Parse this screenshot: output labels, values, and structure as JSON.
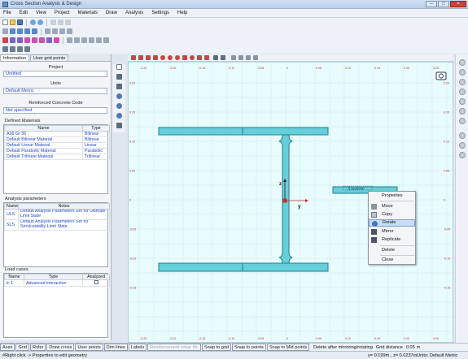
{
  "window": {
    "title": "Cross Section Analysis & Design"
  },
  "menu": [
    "File",
    "Edit",
    "View",
    "Project",
    "Materials",
    "Draw",
    "Analysis",
    "Settings",
    "Help"
  ],
  "tabs": [
    "Information",
    "User grid points"
  ],
  "project": {
    "label": "Project",
    "value": "Untitled"
  },
  "units": {
    "label": "Units",
    "value": "Default Metric"
  },
  "concrete_code": {
    "label": "Reinforced Concrete Code",
    "value": "Not specified"
  },
  "materials": {
    "title": "Defined Materials",
    "headers": [
      "Name",
      "Type"
    ],
    "rows": [
      [
        "A36 Gr 36",
        "Bilinear"
      ],
      [
        "Default Bilinear Material",
        "Bilinear"
      ],
      [
        "Default Linear Material",
        "Linear"
      ],
      [
        "Default Parabolic Material",
        "Parabolic"
      ],
      [
        "Default Trilinear Material",
        "Trilinear"
      ]
    ]
  },
  "analysis_params": {
    "title": "Analysis parameters",
    "headers": [
      "Name",
      "Notes"
    ],
    "rows": [
      [
        "ULS",
        "Default Analysis Parameters Set for Ultimate Limit State"
      ],
      [
        "SLS",
        "Default Analysis Parameters Set for Serviceability Limit State"
      ]
    ]
  },
  "load_cases": {
    "title": "Load cases",
    "headers": [
      "Name",
      "Type",
      "Analyzed"
    ],
    "rows": [
      [
        "lc 1",
        "Advanced interaction",
        ""
      ]
    ]
  },
  "axis_ticks": {
    "top": [
      "-0.25",
      "-0.20",
      "-0.15",
      "-0.10",
      "-0.05",
      "0",
      "0.05",
      "0.10",
      "0.15",
      "0.20",
      "0.25"
    ],
    "left": [
      "0.20",
      "0.15",
      "0.10",
      "0.05",
      "0",
      "-0.05",
      "-0.10",
      "-0.15"
    ]
  },
  "canvas": {
    "axis_z": "z",
    "axis_y": "y",
    "selected_label": "2 sections"
  },
  "context_menu": [
    "Properties",
    "Move",
    "Copy",
    "Rotate",
    "Mirror",
    "Replicate",
    "Delete",
    "Close"
  ],
  "bottom_buttons": [
    "Axes",
    "Grid",
    "Ruler",
    "Draw cross",
    "User points",
    "Dim lines",
    "Labels",
    "Reinforcement rebar Nr.",
    "Snap to grid",
    "Snap to points",
    "Snap to Mid points"
  ],
  "bottom_info": {
    "delete_after": "Delete after mirroring/rotating",
    "grid_label": "Grid distance",
    "grid_value": "0.05",
    "grid_unit": "m"
  },
  "status": {
    "left": "#Right click -> Properties to edit geometry",
    "coord": "y= 0.199m , z= 0.0237m",
    "units": "Units: Default Metric"
  },
  "colors": {
    "section_fill": "#66cfd9",
    "section_stroke": "#1f7f8c",
    "canvas_bg": "#e8fbfd",
    "grid": "#9fd6e0",
    "axis": "#c0312b"
  }
}
